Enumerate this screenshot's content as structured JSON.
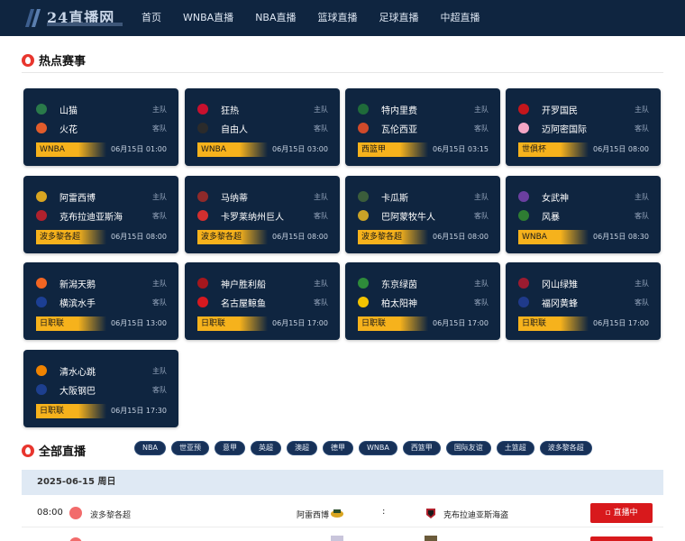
{
  "header": {
    "logo_text": "24直播网",
    "nav": [
      "首页",
      "WNBA直播",
      "NBA直播",
      "篮球直播",
      "足球直播",
      "中超直播"
    ]
  },
  "hot": {
    "title": "热点赛事",
    "cards": [
      {
        "home": "山猫",
        "away": "火花",
        "league": "WNBA",
        "time": "06月15日 01:00",
        "home_color": "#2a7a4a",
        "away_color": "#e25c2b"
      },
      {
        "home": "狂热",
        "away": "自由人",
        "league": "WNBA",
        "time": "06月15日 03:00",
        "home_color": "#c8102e",
        "away_color": "#2b2b2b"
      },
      {
        "home": "特内里费",
        "away": "瓦伦西亚",
        "league": "西篮甲",
        "time": "06月15日 03:15",
        "home_color": "#1f6b3a",
        "away_color": "#d04a2a"
      },
      {
        "home": "开罗国民",
        "away": "迈阿密国际",
        "league": "世俱杯",
        "time": "06月15日 08:00",
        "home_color": "#c4161c",
        "away_color": "#f4a6c5"
      },
      {
        "home": "阿雷西博",
        "away": "克布拉迪亚斯海",
        "league": "波多黎各超",
        "time": "06月15日 08:00",
        "home_color": "#d9a521",
        "away_color": "#b0212d"
      },
      {
        "home": "马纳蒂",
        "away": "卡罗莱纳州巨人",
        "league": "波多黎各超",
        "time": "06月15日 08:00",
        "home_color": "#8f2a2a",
        "away_color": "#d32f2f"
      },
      {
        "home": "卡瓜斯",
        "away": "巴阿蒙牧牛人",
        "league": "波多黎各超",
        "time": "06月15日 08:00",
        "home_color": "#3b5d3b",
        "away_color": "#c9a227"
      },
      {
        "home": "女武神",
        "away": "风暴",
        "league": "WNBA",
        "time": "06月15日 08:30",
        "home_color": "#6b3fa0",
        "away_color": "#2e7d32"
      },
      {
        "home": "新潟天鹅",
        "away": "横滨水手",
        "league": "日职联",
        "time": "06月15日 13:00",
        "home_color": "#f26522",
        "away_color": "#1c3f94"
      },
      {
        "home": "神户胜利船",
        "away": "名古屋鲸鱼",
        "league": "日职联",
        "time": "06月15日 17:00",
        "home_color": "#a4171d",
        "away_color": "#d71920"
      },
      {
        "home": "东京绿茵",
        "away": "柏太阳神",
        "league": "日职联",
        "time": "06月15日 17:00",
        "home_color": "#2e8b3a",
        "away_color": "#f3c300"
      },
      {
        "home": "冈山绿雉",
        "away": "福冈黄蜂",
        "league": "日职联",
        "time": "06月15日 17:00",
        "home_color": "#9b1b30",
        "away_color": "#1f3a8a"
      },
      {
        "home": "清水心跳",
        "away": "大阪钢巴",
        "league": "日职联",
        "time": "06月15日 17:30",
        "home_color": "#f08300",
        "away_color": "#1d3f8f"
      }
    ]
  },
  "all": {
    "title": "全部直播",
    "filters": [
      "NBA",
      "世亚预",
      "意甲",
      "英超",
      "澳超",
      "德甲",
      "WNBA",
      "西篮甲",
      "国际友谊",
      "土篮超",
      "波多黎各超"
    ],
    "date": "2025-06-15 周日",
    "match": {
      "time": "08:00",
      "league": "波多黎各超",
      "home": "阿雷西博",
      "vs": ":",
      "away": "克布拉迪亚斯海盗",
      "status": "直播中"
    }
  },
  "colors": {
    "header_bg": "#0f2540",
    "card_bg": "#0f2540",
    "league_badge": "#f6b21c",
    "live_button": "#d8191c",
    "accent": "#e8362e"
  },
  "labels": {
    "home_role": "主队",
    "away_role": "客队"
  }
}
